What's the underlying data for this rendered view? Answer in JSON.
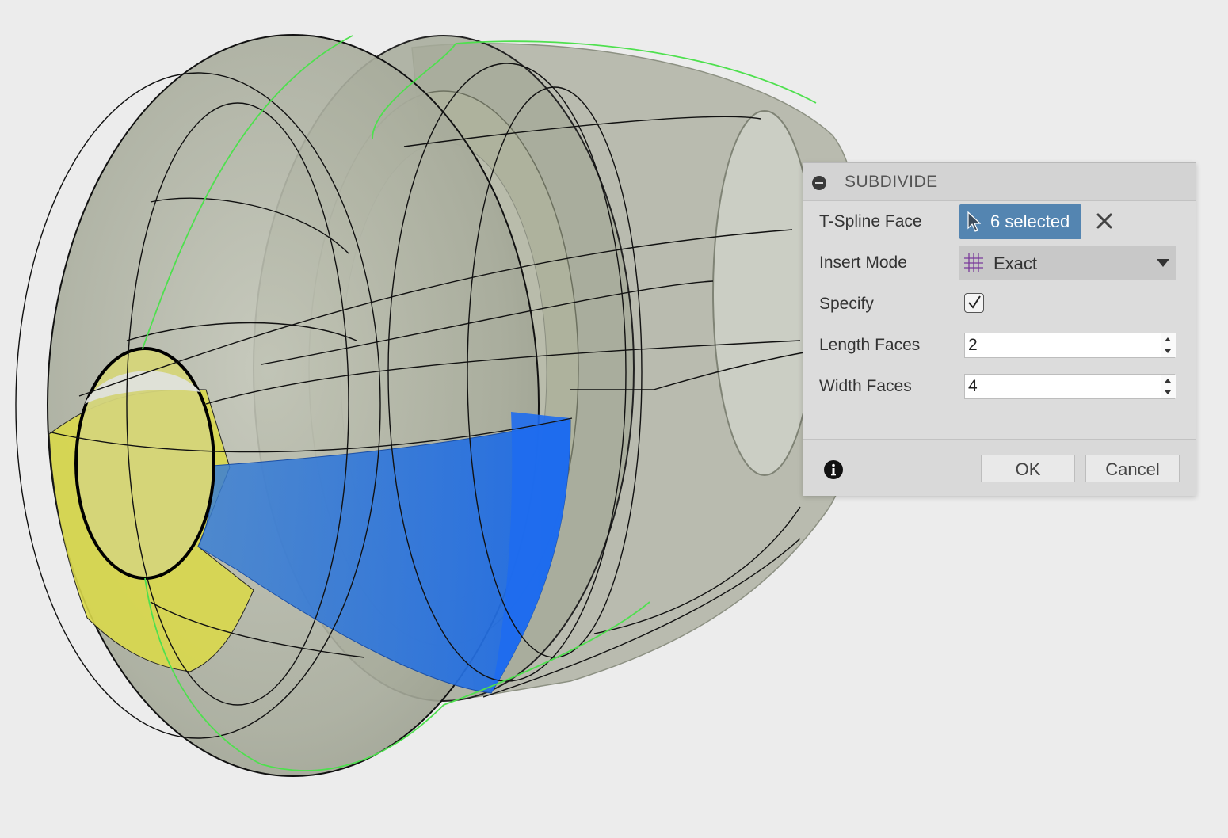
{
  "dialog": {
    "title": "SUBDIVIDE",
    "rows": {
      "tspline_face_label": "T-Spline Face",
      "selection_text": "6 selected",
      "insert_mode_label": "Insert Mode",
      "insert_mode_value": "Exact",
      "specify_label": "Specify",
      "specify_checked": true,
      "length_faces_label": "Length Faces",
      "length_faces_value": "2",
      "width_faces_label": "Width Faces",
      "width_faces_value": "4"
    },
    "ok_label": "OK",
    "cancel_label": "Cancel"
  },
  "icons": {
    "collapse": "minus-circle-icon",
    "selection_cursor": "arrow-cursor-icon",
    "clear": "close-icon",
    "insert_mode": "grid-icon",
    "dropdown": "chevron-down-icon",
    "info": "info-icon"
  },
  "colors": {
    "background": "#ececec",
    "body_tint": "#a9ad9e",
    "selected_face_blue": "#2f74d6",
    "selected_face_yellow": "#d8d84a",
    "green_edge": "#4ee04e",
    "selection_chip": "#5485b1"
  }
}
